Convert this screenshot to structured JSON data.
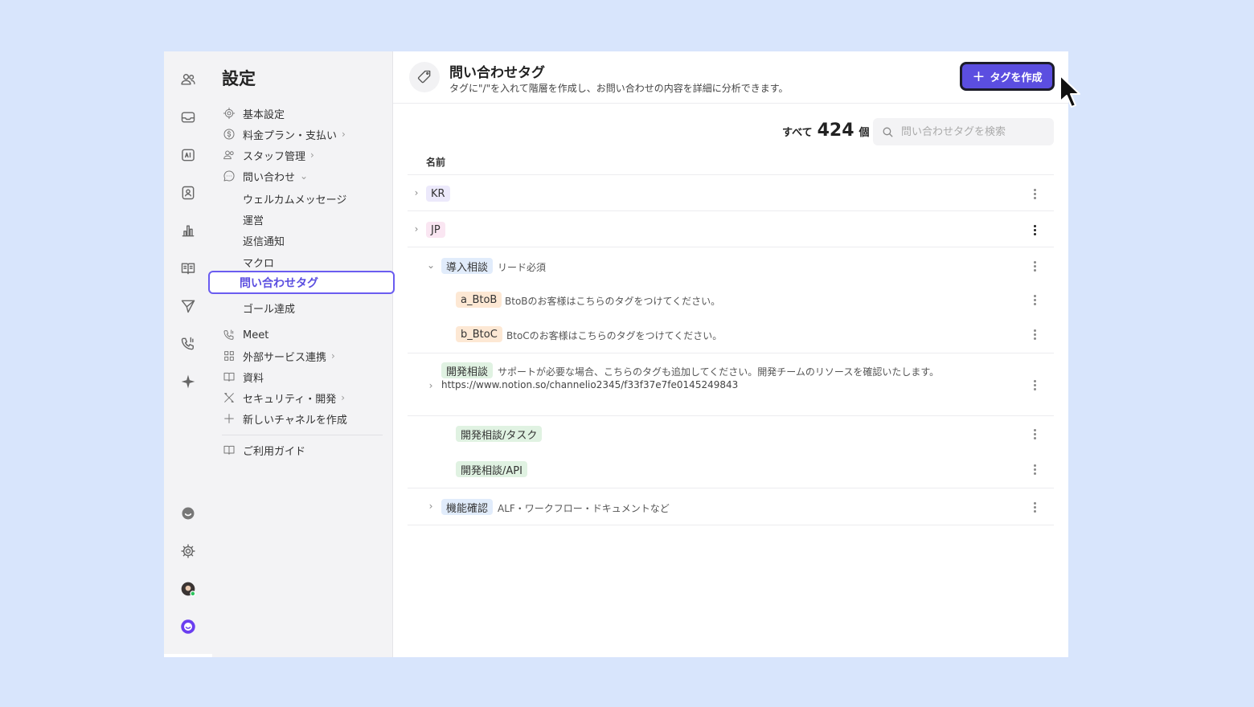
{
  "sidebar": {
    "title": "設定",
    "items": [
      {
        "label": "基本設定",
        "icon": "gear-icon"
      },
      {
        "label": "料金プラン・支払い",
        "icon": "dollar-icon"
      },
      {
        "label": "スタッフ管理",
        "icon": "people-icon"
      },
      {
        "label": "問い合わせ",
        "icon": "chat-icon"
      }
    ],
    "subitems": [
      "ウェルカムメッセージ",
      "運営",
      "返信通知",
      "マクロ",
      "問い合わせタグ",
      "ゴール達成"
    ],
    "items2": [
      {
        "label": "Meet",
        "icon": "phone-icon"
      },
      {
        "label": "外部サービス連携",
        "icon": "grid-icon"
      },
      {
        "label": "資料",
        "icon": "book-icon"
      },
      {
        "label": "セキュリティ・開発",
        "icon": "tools-icon"
      },
      {
        "label": "新しいチャネルを作成",
        "icon": "plus-icon"
      }
    ],
    "guide": "ご利用ガイド"
  },
  "header": {
    "title": "問い合わせタグ",
    "subtitle": "タグに\"/\"を入れて階層を作成し、お問い合わせの内容を詳細に分析できます。",
    "create_button": "タグを作成"
  },
  "summary": {
    "all_label": "すべて",
    "count": "424",
    "unit": "個"
  },
  "search": {
    "placeholder": "問い合わせタグを検索"
  },
  "table": {
    "column": "名前",
    "rows": [
      {
        "tag": "KR",
        "desc": ""
      },
      {
        "tag": "JP",
        "desc": ""
      },
      {
        "tag": "導入相談",
        "desc": "リード必須"
      },
      {
        "tag": "a_BtoB",
        "desc": "BtoBのお客様はこちらのタグをつけてください。"
      },
      {
        "tag": "b_BtoC",
        "desc": "BtoCのお客様はこちらのタグをつけてください。"
      },
      {
        "tag": "開発相談",
        "desc": "サポートが必要な場合、こちらのタグも追加してください。開発チームのリソースを確認いたします。",
        "link": "https://www.notion.so/channelio2345/f33f37e7fe0145249843"
      },
      {
        "tag": "開発相談/タスク",
        "desc": ""
      },
      {
        "tag": "開発相談/API",
        "desc": ""
      },
      {
        "tag": "機能確認",
        "desc": "ALF・ワークフロー・ドキュメントなど"
      }
    ]
  },
  "colors": {
    "accent": "#5b4ee0",
    "background": "#d8e5fc"
  }
}
